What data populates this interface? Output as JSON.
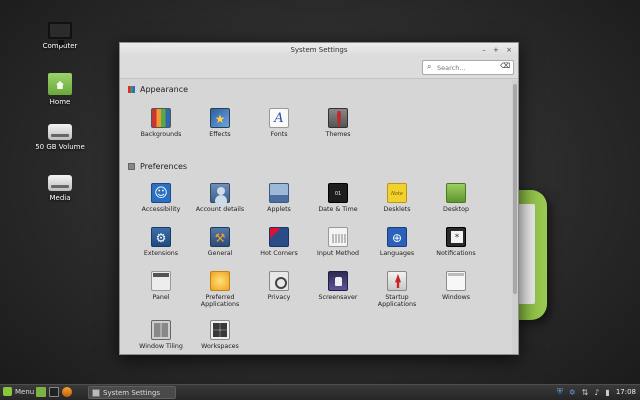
{
  "desktop": {
    "icons": [
      {
        "label": "Computer",
        "icon": "computer-icon"
      },
      {
        "label": "Home",
        "icon": "home-folder-icon"
      },
      {
        "label": "50 GB Volume",
        "icon": "drive-icon"
      },
      {
        "label": "Media",
        "icon": "drive-icon"
      }
    ]
  },
  "window": {
    "title": "System Settings",
    "buttons": {
      "minimize": "–",
      "maximize": "+",
      "close": "×"
    },
    "search": {
      "placeholder": "Search...",
      "search_icon": "⌕",
      "clear_icon": "⌫"
    },
    "sections": {
      "appearance": {
        "title": "Appearance",
        "items": [
          "Backgrounds",
          "Effects",
          "Fonts",
          "Themes"
        ]
      },
      "preferences": {
        "title": "Preferences",
        "items": [
          "Accessibility",
          "Account details",
          "Applets",
          "Date & Time",
          "Desklets",
          "Desktop",
          "Extensions",
          "General",
          "Hot Corners",
          "Input Method",
          "Languages",
          "Notifications",
          "Panel",
          "Preferred Applications",
          "Privacy",
          "Screensaver",
          "Startup Applications",
          "Windows",
          "Window Tiling",
          "Workspaces"
        ]
      }
    },
    "icon_glyphs": {
      "fonts": "A",
      "date": "01",
      "desklets": "Note",
      "extensions": "⚙",
      "general": "⚒",
      "languages": "⊕"
    }
  },
  "taskbar": {
    "menu_label": "Menu",
    "task_label": "System Settings",
    "tray": {
      "shield": "⛨",
      "bluetooth": "✡",
      "network": "⇅",
      "volume": "♪",
      "battery": "▮",
      "clock": "17:08"
    }
  },
  "colors": {
    "accent_green": "#8cc43b",
    "window_bg": "#d6d6d6",
    "taskbar_bg": "#262626"
  }
}
